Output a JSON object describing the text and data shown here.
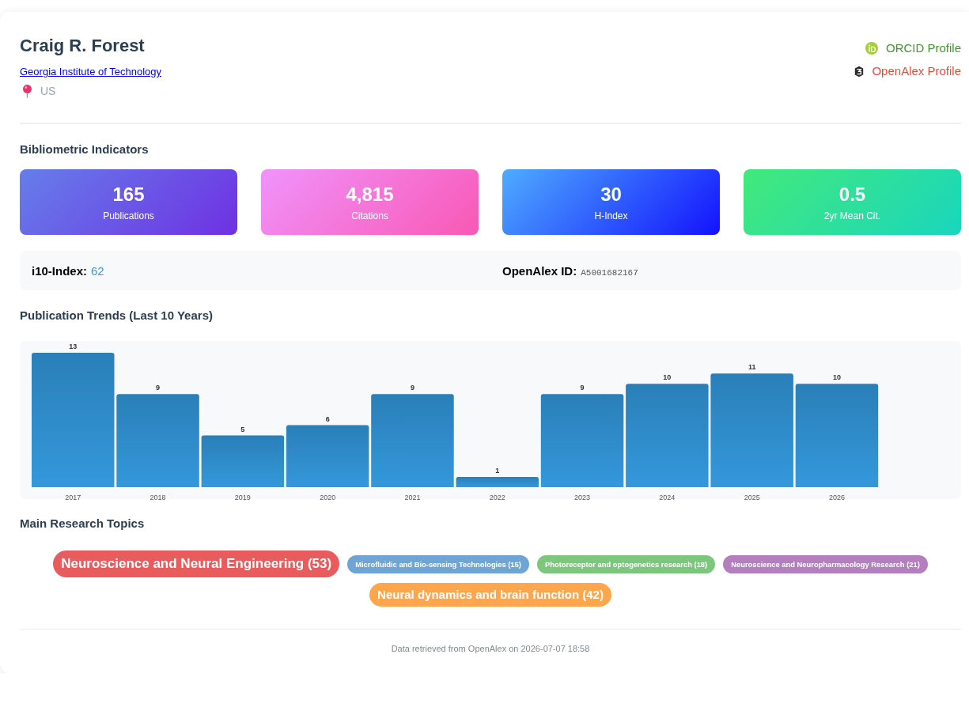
{
  "author": {
    "name": "Craig R. Forest",
    "institution": "Georgia Institute of Technology",
    "country": "US"
  },
  "profile_links": [
    {
      "kind": "orcid",
      "label": "ORCID Profile"
    },
    {
      "kind": "openalex",
      "label": "OpenAlex Profile"
    }
  ],
  "indicators": {
    "title": "Bibliometric Indicators",
    "metrics": [
      {
        "value": "165",
        "label": "Publications",
        "color": "#667eea"
      },
      {
        "value": "4,815",
        "label": "Citations",
        "color": "#f093fb"
      },
      {
        "value": "30",
        "label": "H-Index",
        "color": "#4facfe"
      },
      {
        "value": "0.5",
        "label": "2yr Mean Cit.",
        "color": "#43e97b"
      }
    ]
  },
  "details": [
    {
      "kind": "number",
      "label": "i10-Index:",
      "value": "62"
    },
    {
      "kind": "code",
      "label": "OpenAlex ID:",
      "value": "A5001682167"
    }
  ],
  "publication_trends": {
    "chart_data": {
      "type": "bar",
      "title": "Publication Trends (Last 10 Years)",
      "categories": [
        "2017",
        "2018",
        "2019",
        "2020",
        "2021",
        "2022",
        "2023",
        "2024",
        "2025",
        "2026"
      ],
      "values": [
        13,
        9,
        5,
        6,
        9,
        1,
        9,
        10,
        11,
        10
      ],
      "data_labels": true
    }
  },
  "topics": {
    "title": "Main Research Topics",
    "items": [
      {
        "kind": "large",
        "label": "Neuroscience and Neural Engineering (53)",
        "color": "#ea5b5e"
      },
      {
        "kind": "small",
        "label": "Microfluidic and Bio-sensing Technologies (15)",
        "color": "#6ea5d4"
      },
      {
        "kind": "small",
        "label": "Photoreceptor and optogenetics research (18)",
        "color": "#7dc67e"
      },
      {
        "kind": "small",
        "label": "Neuroscience and Neuropharmacology Research (21)",
        "color": "#b47fbf"
      },
      {
        "kind": "medium",
        "label": "Neural dynamics and brain function (42)",
        "color": "#ffa64d"
      }
    ]
  },
  "footer": "Data retrieved from OpenAlex on 2026-07-07 18:58"
}
